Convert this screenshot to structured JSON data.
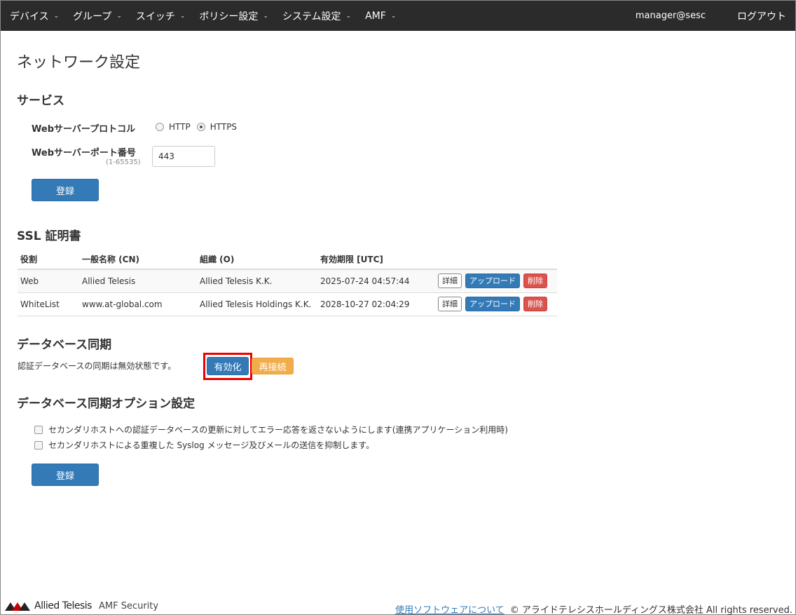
{
  "nav": {
    "items": [
      {
        "label": "デバイス"
      },
      {
        "label": "グループ"
      },
      {
        "label": "スイッチ"
      },
      {
        "label": "ポリシー設定"
      },
      {
        "label": "システム設定"
      },
      {
        "label": "AMF"
      }
    ],
    "user": "manager@sesc",
    "logout": "ログアウト"
  },
  "page_title": "ネットワーク設定",
  "service": {
    "title": "サービス",
    "protocol_label": "Webサーバープロトコル",
    "protocol_options": [
      "HTTP",
      "HTTPS"
    ],
    "protocol_selected": "HTTPS",
    "port_label": "Webサーバーポート番号",
    "port_range": "(1-65535)",
    "port_value": "443",
    "submit_label": "登録"
  },
  "ssl": {
    "title": "SSL 証明書",
    "columns": [
      "役割",
      "一般名称 (CN)",
      "組織 (O)",
      "有効期限 [UTC]"
    ],
    "rows": [
      {
        "role": "Web",
        "cn": "Allied Telesis",
        "org": "Allied Telesis K.K.",
        "expiry": "2025-07-24 04:57:44"
      },
      {
        "role": "WhiteList",
        "cn": "www.at-global.com",
        "org": "Allied Telesis Holdings K.K.",
        "expiry": "2028-10-27 02:04:29"
      }
    ],
    "detail_label": "詳細",
    "upload_label": "アップロード",
    "delete_label": "削除"
  },
  "db_sync": {
    "title": "データベース同期",
    "status_text": "認証データベースの同期は無効状態です。",
    "enable_label": "有効化",
    "reconnect_label": "再接続"
  },
  "db_sync_options": {
    "title": "データベース同期オプション設定",
    "options": [
      {
        "label": "セカンダリホストへの認証データベースの更新に対してエラー応答を返さないようにします(連携アプリケーション利用時)",
        "checked": false
      },
      {
        "label": "セカンダリホストによる重複した Syslog メッセージ及びメールの送信を抑制します。",
        "checked": false
      }
    ],
    "submit_label": "登録"
  },
  "footer": {
    "brand": "Allied Telesis",
    "product": "AMF Security",
    "software_link": "使用ソフトウェアについて",
    "copyright": "© アライドテレシスホールディングス株式会社 All rights reserved."
  },
  "colors": {
    "navbar": "#2b2b2b",
    "primary": "#337ab7",
    "danger": "#d9534f",
    "warning": "#f0ad4e",
    "highlight": "#ee0000"
  }
}
